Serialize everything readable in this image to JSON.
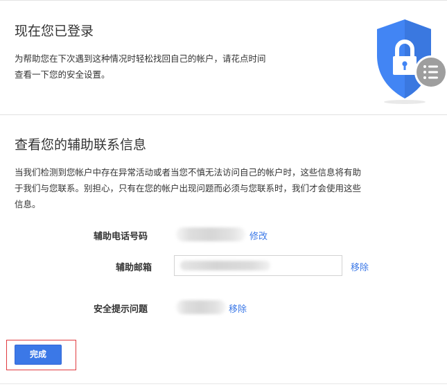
{
  "signed_in": {
    "title": "现在您已登录",
    "description_lines": [
      "为帮助您在下次遇到这种情况时轻松找回自己的帐户，请花点时间",
      "查看一下您的安全设置。"
    ],
    "icon": "shield-lock-icon"
  },
  "recovery": {
    "title": "查看您的辅助联系信息",
    "description_lines": [
      "当我们检测到您帐户中存在异常活动或者当您不慎无法访问自己的帐户时，这些信息将有助",
      "于我们与您联系。别担心，只有在您的帐户出现问题而必须与您联系时，我们才会使用这些",
      "信息。"
    ],
    "phone": {
      "label": "辅助电话号码",
      "action": "修改"
    },
    "email": {
      "label": "辅助邮箱",
      "action": "移除"
    },
    "security_question": {
      "label": "安全提示问题",
      "action": "移除"
    }
  },
  "done_button": {
    "label": "完成"
  },
  "colors": {
    "accent": "#3b78e7",
    "shield_blue": "#4285f4",
    "highlight_border": "#e0393e",
    "badge_gray": "#9e9e9e"
  }
}
